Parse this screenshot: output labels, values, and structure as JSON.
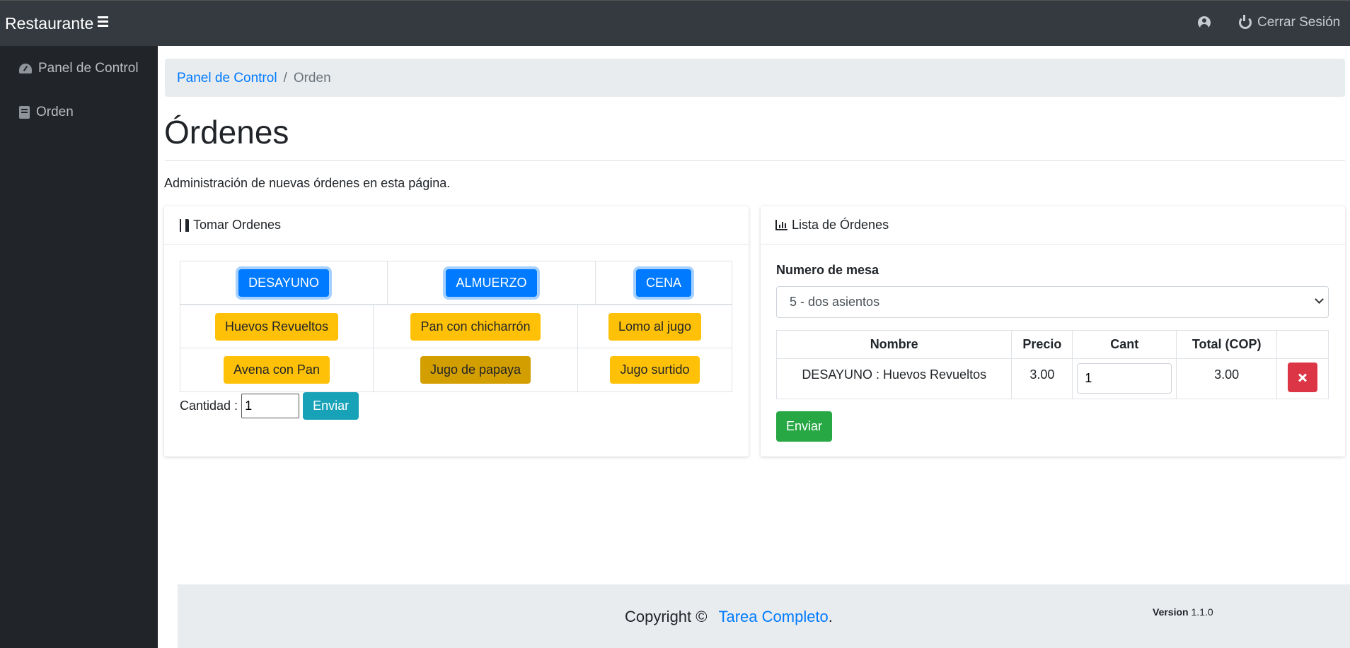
{
  "topbar": {
    "brand": "Restaurante",
    "logout_label": "Cerrar Sesión"
  },
  "sidebar": {
    "items": [
      {
        "label": "Panel de Control",
        "icon": "tachometer-icon"
      },
      {
        "label": "Orden",
        "icon": "book-icon"
      }
    ]
  },
  "breadcrumb": {
    "link": "Panel de Control",
    "separator": "/",
    "current": "Orden"
  },
  "page": {
    "title": "Órdenes",
    "subtitle": "Administración de nuevas órdenes en esta página."
  },
  "take_orders": {
    "header": "Tomar Ordenes",
    "categories": [
      "DESAYUNO",
      "ALMUERZO",
      "CENA"
    ],
    "items_row1": [
      "Huevos Revueltos",
      "Pan con chicharrón",
      "Lomo al jugo"
    ],
    "items_row2": [
      "Avena con Pan",
      "Jugo de papaya",
      "Jugo surtido"
    ],
    "quantity_label": "Cantidad :",
    "quantity_value": "1",
    "submit_label": "Enviar"
  },
  "order_list": {
    "header": "Lista de Órdenes",
    "table_label": "Numero de mesa",
    "table_selected": "5 - dos asientos",
    "columns": [
      "Nombre",
      "Precio",
      "Cant",
      "Total (COP)",
      ""
    ],
    "rows": [
      {
        "name": "DESAYUNO : Huevos Revueltos",
        "price": "3.00",
        "qty": "1",
        "total": "3.00"
      }
    ],
    "submit_label": "Enviar"
  },
  "footer": {
    "copyright": "Copyright ©",
    "link": "Tarea Completo",
    "period": ".",
    "version_label": "Version",
    "version_number": "1.1.0"
  },
  "colors": {
    "topbar": "#343a40",
    "sidebar": "#212529",
    "primary": "#007bff",
    "warning": "#ffc107",
    "info": "#17a2b8",
    "success": "#28a745",
    "danger": "#dc3545"
  }
}
